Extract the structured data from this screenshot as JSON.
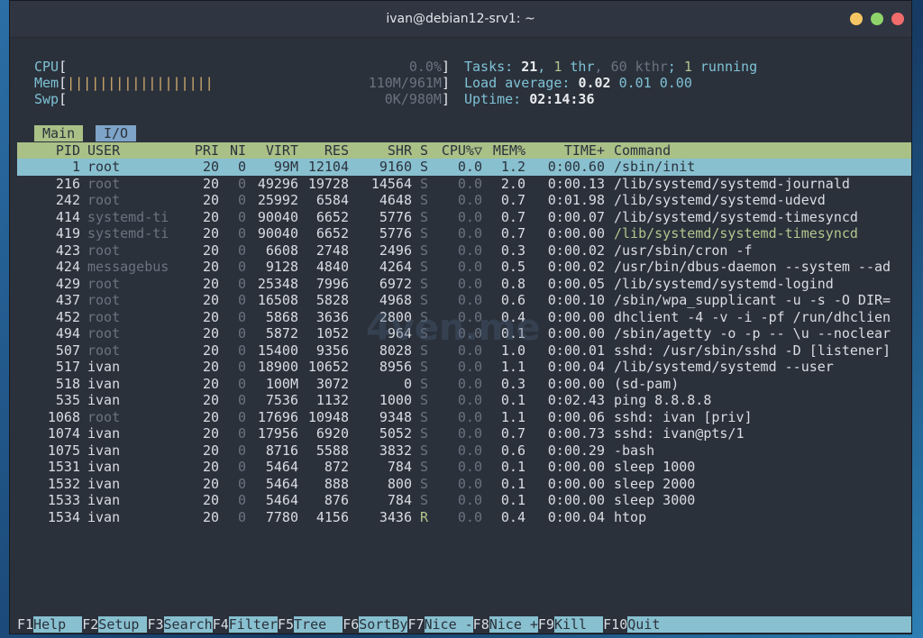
{
  "window": {
    "title": "ivan@debian12-srv1: ~"
  },
  "meters": {
    "cpu_label": "CPU",
    "cpu_value": "0.0%",
    "mem_label": "Mem",
    "mem_bar": "||||||||||||||||||",
    "mem_value": "110M/961M",
    "swp_label": "Swp",
    "swp_value": "0K/980M"
  },
  "summary": {
    "tasks_label": "Tasks: ",
    "tasks": "21",
    "thr": "1",
    "thr_label": " thr",
    "kthr": "60 kthr",
    "running": "1",
    "running_label": " running",
    "load_label": "Load average: ",
    "load1": "0.02",
    "load5": "0.01",
    "load15": "0.00",
    "uptime_label": "Uptime: ",
    "uptime": "02:14:36"
  },
  "tabs": {
    "main": "Main",
    "io": "I/O"
  },
  "columns": {
    "pid": "PID",
    "user": "USER",
    "pri": "PRI",
    "ni": "NI",
    "virt": "VIRT",
    "res": "RES",
    "shr": "SHR",
    "s": "S",
    "cpu": "CPU%▽",
    "mem": "MEM%",
    "time": "TIME+",
    "cmd": "Command"
  },
  "processes": [
    {
      "pid": "1",
      "user": "root",
      "pri": "20",
      "ni": "0",
      "virt": "99M",
      "res": "12104",
      "shr": "9160",
      "s": "S",
      "cpu": "0.0",
      "mem": "1.2",
      "time": "0:00.60",
      "cmd": "/sbin/init"
    },
    {
      "pid": "216",
      "user": "root",
      "pri": "20",
      "ni": "0",
      "virt": "49296",
      "res": "19728",
      "shr": "14564",
      "s": "S",
      "cpu": "0.0",
      "mem": "2.0",
      "time": "0:00.13",
      "cmd": "/lib/systemd/systemd-journald"
    },
    {
      "pid": "242",
      "user": "root",
      "pri": "20",
      "ni": "0",
      "virt": "25992",
      "res": "6584",
      "shr": "4648",
      "s": "S",
      "cpu": "0.0",
      "mem": "0.7",
      "time": "0:01.98",
      "cmd": "/lib/systemd/systemd-udevd"
    },
    {
      "pid": "414",
      "user": "systemd-ti",
      "pri": "20",
      "ni": "0",
      "virt": "90040",
      "res": "6652",
      "shr": "5776",
      "s": "S",
      "cpu": "0.0",
      "mem": "0.7",
      "time": "0:00.07",
      "cmd": "/lib/systemd/systemd-timesyncd"
    },
    {
      "pid": "419",
      "user": "systemd-ti",
      "pri": "20",
      "ni": "0",
      "virt": "90040",
      "res": "6652",
      "shr": "5776",
      "s": "S",
      "cpu": "0.0",
      "mem": "0.7",
      "time": "0:00.00",
      "cmd": "/lib/systemd/systemd-timesyncd"
    },
    {
      "pid": "423",
      "user": "root",
      "pri": "20",
      "ni": "0",
      "virt": "6608",
      "res": "2748",
      "shr": "2496",
      "s": "S",
      "cpu": "0.0",
      "mem": "0.3",
      "time": "0:00.02",
      "cmd": "/usr/sbin/cron -f"
    },
    {
      "pid": "424",
      "user": "messagebus",
      "pri": "20",
      "ni": "0",
      "virt": "9128",
      "res": "4840",
      "shr": "4264",
      "s": "S",
      "cpu": "0.0",
      "mem": "0.5",
      "time": "0:00.02",
      "cmd": "/usr/bin/dbus-daemon --system --ad"
    },
    {
      "pid": "429",
      "user": "root",
      "pri": "20",
      "ni": "0",
      "virt": "25348",
      "res": "7996",
      "shr": "6972",
      "s": "S",
      "cpu": "0.0",
      "mem": "0.8",
      "time": "0:00.05",
      "cmd": "/lib/systemd/systemd-logind"
    },
    {
      "pid": "437",
      "user": "root",
      "pri": "20",
      "ni": "0",
      "virt": "16508",
      "res": "5828",
      "shr": "4968",
      "s": "S",
      "cpu": "0.0",
      "mem": "0.6",
      "time": "0:00.10",
      "cmd": "/sbin/wpa_supplicant -u -s -O DIR="
    },
    {
      "pid": "452",
      "user": "root",
      "pri": "20",
      "ni": "0",
      "virt": "5868",
      "res": "3636",
      "shr": "2800",
      "s": "S",
      "cpu": "0.0",
      "mem": "0.4",
      "time": "0:00.00",
      "cmd": "dhclient -4 -v -i -pf /run/dhclien"
    },
    {
      "pid": "494",
      "user": "root",
      "pri": "20",
      "ni": "0",
      "virt": "5872",
      "res": "1052",
      "shr": "964",
      "s": "S",
      "cpu": "0.0",
      "mem": "0.1",
      "time": "0:00.00",
      "cmd": "/sbin/agetty -o -p -- \\u --noclear"
    },
    {
      "pid": "507",
      "user": "root",
      "pri": "20",
      "ni": "0",
      "virt": "15400",
      "res": "9356",
      "shr": "8028",
      "s": "S",
      "cpu": "0.0",
      "mem": "1.0",
      "time": "0:00.01",
      "cmd": "sshd: /usr/sbin/sshd -D [listener]"
    },
    {
      "pid": "517",
      "user": "ivan",
      "pri": "20",
      "ni": "0",
      "virt": "18900",
      "res": "10652",
      "shr": "8956",
      "s": "S",
      "cpu": "0.0",
      "mem": "1.1",
      "time": "0:00.04",
      "cmd": "/lib/systemd/systemd --user"
    },
    {
      "pid": "518",
      "user": "ivan",
      "pri": "20",
      "ni": "0",
      "virt": "100M",
      "res": "3072",
      "shr": "0",
      "s": "S",
      "cpu": "0.0",
      "mem": "0.3",
      "time": "0:00.00",
      "cmd": "(sd-pam)"
    },
    {
      "pid": "535",
      "user": "ivan",
      "pri": "20",
      "ni": "0",
      "virt": "7536",
      "res": "1132",
      "shr": "1000",
      "s": "S",
      "cpu": "0.0",
      "mem": "0.1",
      "time": "0:02.43",
      "cmd": "ping 8.8.8.8"
    },
    {
      "pid": "1068",
      "user": "root",
      "pri": "20",
      "ni": "0",
      "virt": "17696",
      "res": "10948",
      "shr": "9348",
      "s": "S",
      "cpu": "0.0",
      "mem": "1.1",
      "time": "0:00.06",
      "cmd": "sshd: ivan [priv]"
    },
    {
      "pid": "1074",
      "user": "ivan",
      "pri": "20",
      "ni": "0",
      "virt": "17956",
      "res": "6920",
      "shr": "5052",
      "s": "S",
      "cpu": "0.0",
      "mem": "0.7",
      "time": "0:00.73",
      "cmd": "sshd: ivan@pts/1"
    },
    {
      "pid": "1075",
      "user": "ivan",
      "pri": "20",
      "ni": "0",
      "virt": "8716",
      "res": "5588",
      "shr": "3832",
      "s": "S",
      "cpu": "0.0",
      "mem": "0.6",
      "time": "0:00.29",
      "cmd": "-bash"
    },
    {
      "pid": "1531",
      "user": "ivan",
      "pri": "20",
      "ni": "0",
      "virt": "5464",
      "res": "872",
      "shr": "784",
      "s": "S",
      "cpu": "0.0",
      "mem": "0.1",
      "time": "0:00.00",
      "cmd": "sleep 1000"
    },
    {
      "pid": "1532",
      "user": "ivan",
      "pri": "20",
      "ni": "0",
      "virt": "5464",
      "res": "888",
      "shr": "800",
      "s": "S",
      "cpu": "0.0",
      "mem": "0.1",
      "time": "0:00.00",
      "cmd": "sleep 2000"
    },
    {
      "pid": "1533",
      "user": "ivan",
      "pri": "20",
      "ni": "0",
      "virt": "5464",
      "res": "876",
      "shr": "784",
      "s": "S",
      "cpu": "0.0",
      "mem": "0.1",
      "time": "0:00.00",
      "cmd": "sleep 3000"
    },
    {
      "pid": "1534",
      "user": "ivan",
      "pri": "20",
      "ni": "0",
      "virt": "7780",
      "res": "4156",
      "shr": "3436",
      "s": "R",
      "cpu": "0.0",
      "mem": "0.4",
      "time": "0:00.04",
      "cmd": "htop"
    }
  ],
  "footer": [
    {
      "key": "F1",
      "label": "Help"
    },
    {
      "key": "F2",
      "label": "Setup"
    },
    {
      "key": "F3",
      "label": "Search"
    },
    {
      "key": "F4",
      "label": "Filter"
    },
    {
      "key": "F5",
      "label": "Tree"
    },
    {
      "key": "F6",
      "label": "SortBy"
    },
    {
      "key": "F7",
      "label": "Nice -"
    },
    {
      "key": "F8",
      "label": "Nice +"
    },
    {
      "key": "F9",
      "label": "Kill"
    },
    {
      "key": "F10",
      "label": "Quit"
    }
  ],
  "watermark": "4ven.me",
  "colors": {
    "accent_green": "#a9c087",
    "accent_cyan": "#88c0d0",
    "background": "#2b313b"
  }
}
